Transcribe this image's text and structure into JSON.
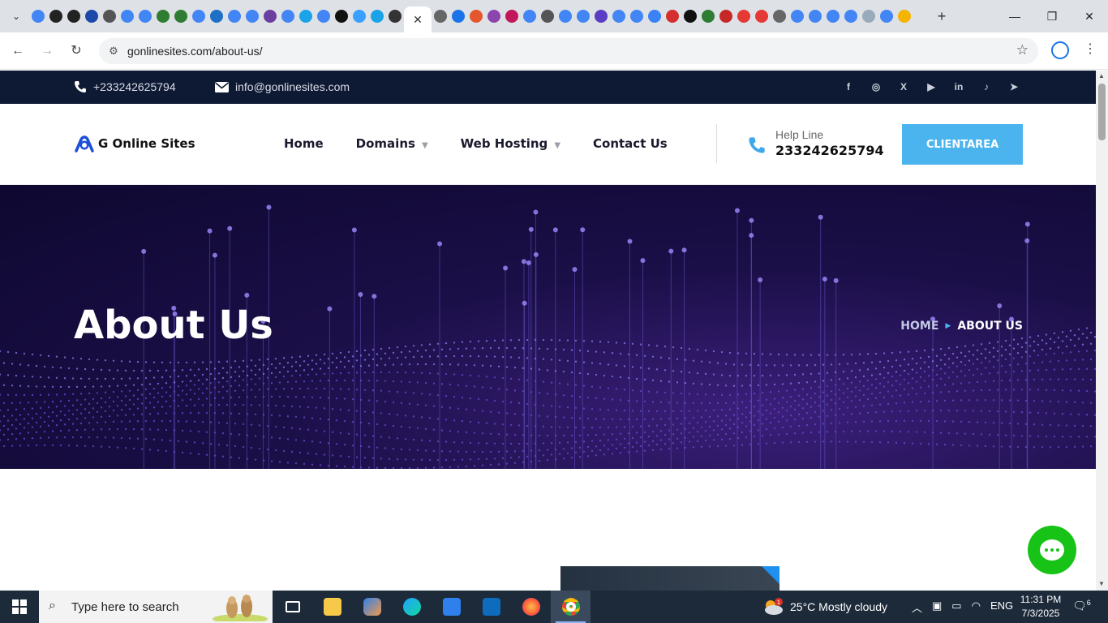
{
  "browser": {
    "url": "gonlinesites.com/about-us/",
    "tab_favicon_colors": [
      "#4285f4",
      "#222222",
      "#222222",
      "#1c4aa8",
      "#555555",
      "#4285f4",
      "#4285f4",
      "#2e7d32",
      "#2e7d32",
      "#4285f4",
      "#1e6fc6",
      "#4285f4",
      "#4285f4",
      "#6b3fa0",
      "#4285f4",
      "#1aa3e8",
      "#4285f4",
      "#111111",
      "#39a0ff",
      "#1aa3e8",
      "#333333"
    ],
    "tab_favicon_colors_right": [
      "#666666",
      "#1a73e8",
      "#e4572e",
      "#8e44ad",
      "#c2185b",
      "#4285f4",
      "#555555",
      "#4285f4",
      "#4285f4",
      "#5b3cc4",
      "#4285f4",
      "#4285f4",
      "#3b82f6",
      "#d32f2f",
      "#111111",
      "#2e7d32",
      "#c62828",
      "#e53935",
      "#e53935",
      "#666666",
      "#4285f4",
      "#4285f4",
      "#4285f4",
      "#4285f4",
      "#9ab",
      "#4285f4",
      "#f4b400"
    ],
    "active_tab_close": "✕",
    "new_tab": "+"
  },
  "topbar": {
    "phone": "+233242625794",
    "email": "info@gonlinesites.com",
    "socials": [
      {
        "name": "facebook-icon",
        "glyph": "f"
      },
      {
        "name": "instagram-icon",
        "glyph": "◎"
      },
      {
        "name": "x-twitter-icon",
        "glyph": "X"
      },
      {
        "name": "youtube-icon",
        "glyph": "▶"
      },
      {
        "name": "linkedin-icon",
        "glyph": "in"
      },
      {
        "name": "tiktok-icon",
        "glyph": "♪"
      },
      {
        "name": "telegram-icon",
        "glyph": "➤"
      }
    ]
  },
  "header": {
    "logo_text": "G Online Sites",
    "nav": {
      "home": "Home",
      "domains": "Domains",
      "web_hosting": "Web Hosting",
      "contact": "Contact Us"
    },
    "helpline_label": "Help Line",
    "helpline_number": "233242625794",
    "cta_label": "CLIENTAREA"
  },
  "hero": {
    "title": "About Us",
    "breadcrumb_home": "HOME",
    "breadcrumb_current": "ABOUT US"
  },
  "taskbar": {
    "search_placeholder": "Type here to search",
    "weather": "25°C  Mostly cloudy",
    "language": "ENG",
    "time": "11:31 PM",
    "date": "7/3/2025",
    "notifications": "6",
    "weather_badge": "1"
  },
  "colors": {
    "topbar_bg": "#0e1a33",
    "accent": "#4bb4ef",
    "hero_bg": "#1b0f48",
    "chat_green": "#17c317"
  }
}
